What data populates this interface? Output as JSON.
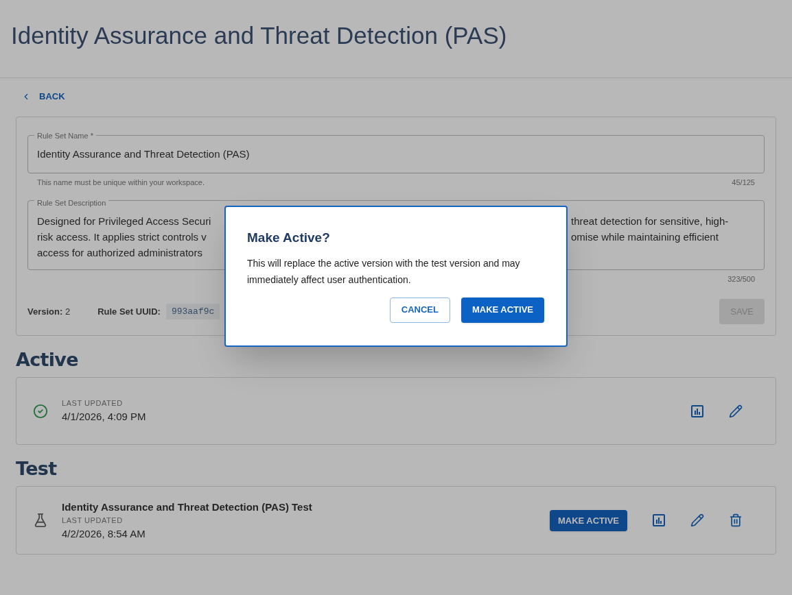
{
  "page_title": "Identity Assurance and Threat Detection (PAS)",
  "back_link": "BACK",
  "form": {
    "name_field": {
      "label": "Rule Set Name *",
      "value": "Identity Assurance and Threat Detection (PAS)",
      "helper": "This name must be unique within your workspace.",
      "counter": "45/125"
    },
    "description_field": {
      "label": "Rule Set Description",
      "visible_left": [
        "Designed for Privileged Access Securi",
        "risk access. It applies strict controls v",
        "access for authorized administrators"
      ],
      "visible_right": [
        "threat detection for sensitive, high-",
        "omise while maintaining efficient"
      ],
      "counter": "323/500"
    },
    "version": {
      "label": "Version:",
      "value": "2"
    },
    "uuid": {
      "label": "Rule Set UUID:",
      "value": "993aaf9c"
    },
    "save_button": {
      "label": "SAVE",
      "disabled": true
    }
  },
  "sections": [
    {
      "kind": "active",
      "heading": "Active",
      "status_label": "LAST UPDATED",
      "date": "4/1/2026, 4:09 PM"
    },
    {
      "kind": "test",
      "heading": "Test",
      "name": "Identity Assurance and Threat Detection (PAS) Test",
      "status_label": "LAST UPDATED",
      "date": "4/2/2026, 8:54 AM",
      "action": "MAKE ACTIVE"
    }
  ],
  "dialog": {
    "title": "Make Active?",
    "body": "This will replace the active version with the test version and may immediately affect user authentication.",
    "cancel": "CANCEL",
    "confirm": "MAKE ACTIVE"
  }
}
